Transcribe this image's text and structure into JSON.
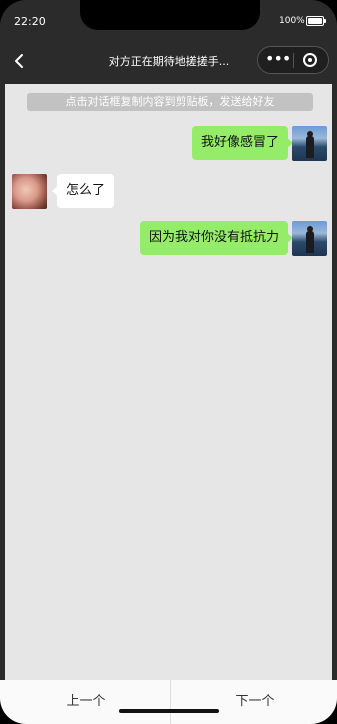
{
  "status": {
    "time": "22:20",
    "battery": "100%"
  },
  "nav": {
    "title": "对方正在期待地搓搓手...",
    "menu_glyph": "•••"
  },
  "chat": {
    "hint": "点击对话框复制内容到剪贴板，发送给好友",
    "messages": [
      {
        "sender": "self",
        "text": "我好像感冒了"
      },
      {
        "sender": "other",
        "text": "怎么了"
      },
      {
        "sender": "self",
        "text": "因为我对你没有抵抗力"
      }
    ]
  },
  "bottom": {
    "prev": "上一个",
    "next": "下一个"
  },
  "colors": {
    "self_bubble": "#95ec69",
    "other_bubble": "#ffffff",
    "chat_bg": "#e6e6e6"
  }
}
